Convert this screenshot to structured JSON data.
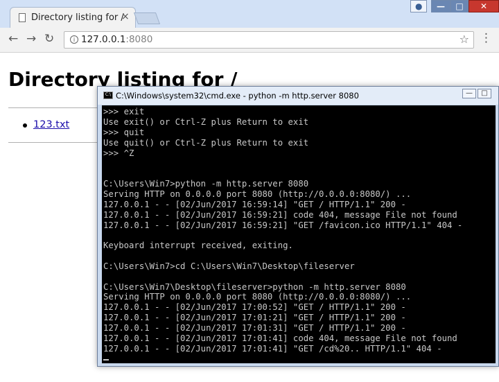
{
  "browser": {
    "tab_title": "Directory listing for /",
    "tab_close": "×",
    "url_host": "127.0.0.1",
    "url_port": ":8080"
  },
  "page": {
    "title": "Directory listing for /",
    "files": [
      "123.txt"
    ]
  },
  "cmd": {
    "title": "C:\\Windows\\system32\\cmd.exe - python  -m http.server 8080",
    "lines": [
      ">>> exit",
      "Use exit() or Ctrl-Z plus Return to exit",
      ">>> quit",
      "Use quit() or Ctrl-Z plus Return to exit",
      ">>> ^Z",
      "",
      "",
      "C:\\Users\\Win7>python -m http.server 8080",
      "Serving HTTP on 0.0.0.0 port 8080 (http://0.0.0.0:8080/) ...",
      "127.0.0.1 - - [02/Jun/2017 16:59:14] \"GET / HTTP/1.1\" 200 -",
      "127.0.0.1 - - [02/Jun/2017 16:59:21] code 404, message File not found",
      "127.0.0.1 - - [02/Jun/2017 16:59:21] \"GET /favicon.ico HTTP/1.1\" 404 -",
      "",
      "Keyboard interrupt received, exiting.",
      "",
      "C:\\Users\\Win7>cd C:\\Users\\Win7\\Desktop\\fileserver",
      "",
      "C:\\Users\\Win7\\Desktop\\fileserver>python -m http.server 8080",
      "Serving HTTP on 0.0.0.0 port 8080 (http://0.0.0.0:8080/) ...",
      "127.0.0.1 - - [02/Jun/2017 17:00:52] \"GET / HTTP/1.1\" 200 -",
      "127.0.0.1 - - [02/Jun/2017 17:01:21] \"GET / HTTP/1.1\" 200 -",
      "127.0.0.1 - - [02/Jun/2017 17:01:31] \"GET / HTTP/1.1\" 200 -",
      "127.0.0.1 - - [02/Jun/2017 17:01:41] code 404, message File not found",
      "127.0.0.1 - - [02/Jun/2017 17:01:41] \"GET /cd%20.. HTTP/1.1\" 404 -"
    ]
  },
  "icons": {
    "back": "back-arrow-icon",
    "forward": "forward-arrow-icon",
    "reload": "reload-icon",
    "info": "info-icon",
    "star": "star-icon",
    "menu": "menu-icon",
    "profile": "profile-icon",
    "page": "page-icon",
    "cmd": "cmd-icon"
  },
  "colors": {
    "link": "#1a0dab",
    "console_bg": "#000000",
    "console_text": "#c8c8c8",
    "close_button": "#c7372e"
  }
}
